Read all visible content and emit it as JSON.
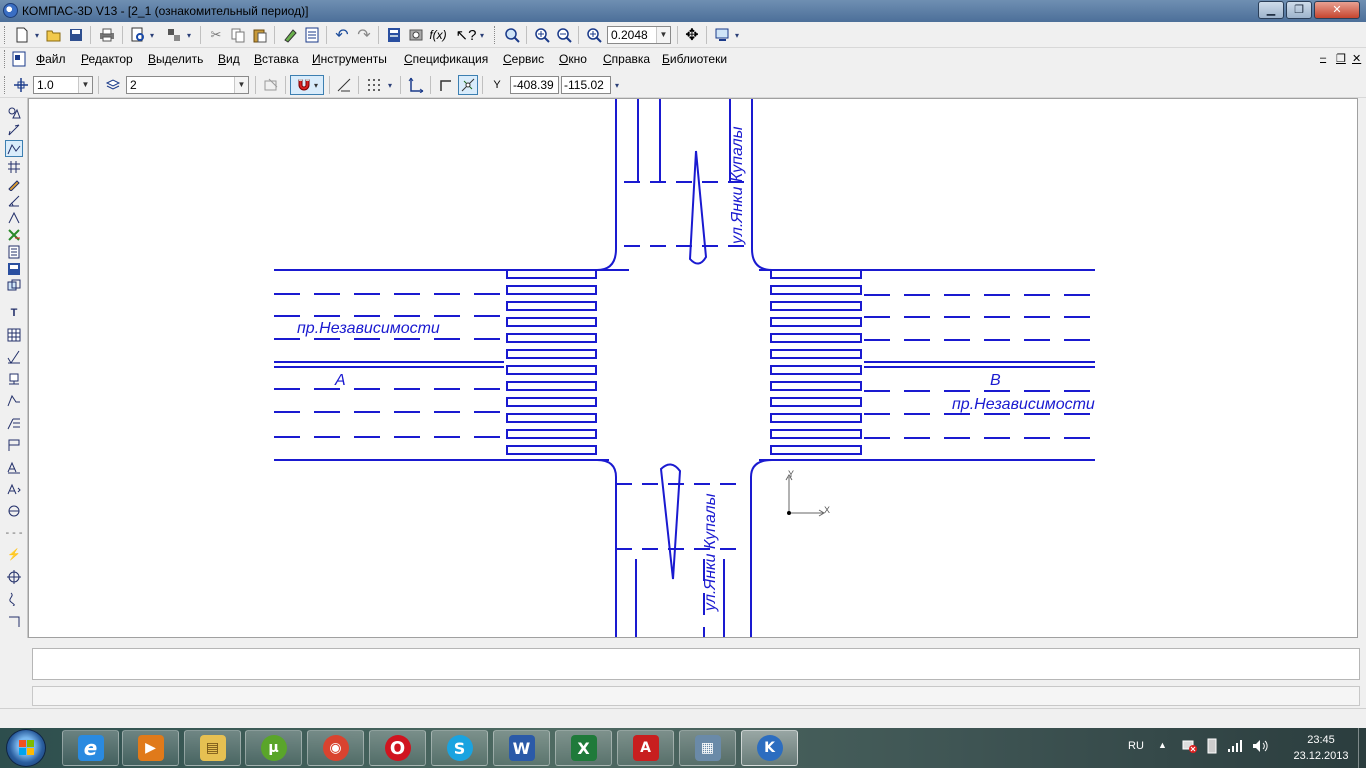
{
  "window": {
    "title": "КОМПАС-3D V13 - [2_1 (ознакомительный период)]",
    "controls": {
      "minimize": "▁",
      "maximize": "❐",
      "close": "✕"
    }
  },
  "standard_toolbar": {
    "zoom_value": "0.2048",
    "icons": [
      "new-document-icon",
      "open-icon",
      "save-icon",
      "print-icon",
      "preview-icon",
      "manager-icon",
      "cut-icon",
      "copy-icon",
      "paste-icon",
      "format-brush-icon",
      "properties-icon",
      "undo-icon",
      "redo-icon",
      "manager-tree-icon",
      "library-icon",
      "variables-icon",
      "help-pointer-icon",
      "zoom-window-icon",
      "zoom-in-icon",
      "zoom-out-icon",
      "zoom-scale-icon",
      "pan-icon",
      "refresh-icon"
    ]
  },
  "menu": {
    "items": [
      "Файл",
      "Редактор",
      "Выделить",
      "Вид",
      "Вставка",
      "Инструменты",
      "Спецификация",
      "Сервис",
      "Окно",
      "Справка",
      "Библиотеки"
    ],
    "doc_controls": {
      "minimize": "‒",
      "restore": "❐",
      "close": "✕"
    }
  },
  "current_state_toolbar": {
    "step": "1.0",
    "layer": "2",
    "coord_x": "-408.39",
    "coord_y": "-115.02",
    "coord_label": "Y"
  },
  "drawing": {
    "avenue_label_left": "пр.Независимости",
    "avenue_label_right": "пр.Независимости",
    "street_label_top": "ул.Янки Купалы",
    "street_label_bottom": "ул.Янки Купалы",
    "point_a": "A",
    "point_b": "B",
    "axis_x": "X",
    "axis_y": "Y",
    "line_color": "#1a1ad0"
  },
  "taskbar": {
    "apps": [
      {
        "name": "ie",
        "glyph": "e",
        "color": "#2a8ae0"
      },
      {
        "name": "media-player",
        "glyph": "▶",
        "color": "#e07a1a"
      },
      {
        "name": "explorer",
        "glyph": "▤",
        "color": "#e6c052"
      },
      {
        "name": "utorrent",
        "glyph": "µ",
        "color": "#5aa52a"
      },
      {
        "name": "chrome",
        "glyph": "◉",
        "color": "#d9432f"
      },
      {
        "name": "opera",
        "glyph": "O",
        "color": "#d0141f"
      },
      {
        "name": "skype",
        "glyph": "S",
        "color": "#1aa3e0"
      },
      {
        "name": "word",
        "glyph": "W",
        "color": "#2b5aa8"
      },
      {
        "name": "excel",
        "glyph": "X",
        "color": "#1f7a3a"
      },
      {
        "name": "acrobat",
        "glyph": "A",
        "color": "#c81f1f"
      },
      {
        "name": "calculator",
        "glyph": "▦",
        "color": "#6a8aa8"
      },
      {
        "name": "kompas",
        "glyph": "K",
        "color": "#2c6dc0"
      }
    ],
    "language": "RU",
    "time": "23:45",
    "date": "23.12.2013"
  }
}
